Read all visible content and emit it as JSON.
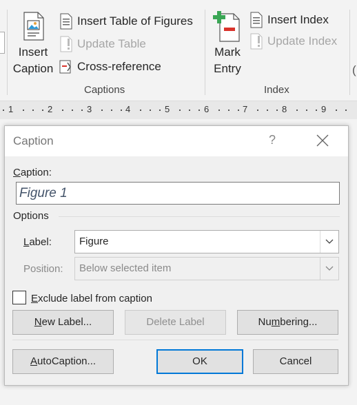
{
  "ribbon": {
    "insert_caption": {
      "line1": "Insert",
      "line2": "Caption"
    },
    "insert_table_of_figures": "Insert Table of Figures",
    "update_table": "Update Table",
    "cross_reference": "Cross-reference",
    "captions_group": "Captions",
    "mark_entry": {
      "line1": "Mark",
      "line2": "Entry"
    },
    "insert_index": "Insert Index",
    "update_index": "Update Index",
    "index_group": "Index"
  },
  "ruler": [
    "1",
    "2",
    "3",
    "4",
    "5",
    "6",
    "7",
    "8",
    "9"
  ],
  "dialog": {
    "title": "Caption",
    "help": "?",
    "caption_label_pre": "C",
    "caption_label_post": "aption:",
    "caption_value": "Figure 1",
    "options_header": "Options",
    "label_label_pre": "L",
    "label_label_post": "abel:",
    "label_value": "Figure",
    "position_label": "Position:",
    "position_value": "Below selected item",
    "exclude_pre": "E",
    "exclude_post": "xclude label from caption",
    "new_label": {
      "pre": "N",
      "post": "ew Label..."
    },
    "delete_label": "Delete Label",
    "numbering": {
      "pre": "Nu",
      "mid": "m",
      "post": "bering..."
    },
    "autocaption": {
      "pre": "A",
      "post": "utoCaption..."
    },
    "ok": "OK",
    "cancel": "Cancel"
  }
}
